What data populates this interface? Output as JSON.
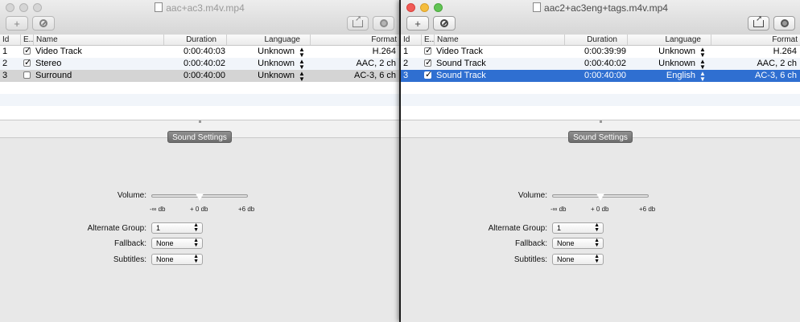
{
  "windows": {
    "left": {
      "title": "aac+ac3.m4v.mp4",
      "headers": {
        "id": "Id",
        "enabled": "E...",
        "name": "Name",
        "duration": "Duration",
        "language": "Language",
        "format": "Format"
      },
      "tracks": [
        {
          "id": "1",
          "enabled": true,
          "name": "Video Track",
          "duration": "0:00:40:03",
          "language": "Unknown",
          "format": "H.264"
        },
        {
          "id": "2",
          "enabled": true,
          "name": "Stereo",
          "duration": "0:00:40:02",
          "language": "Unknown",
          "format": "AAC, 2 ch"
        },
        {
          "id": "3",
          "enabled": false,
          "name": "Surround",
          "duration": "0:00:40:00",
          "language": "Unknown",
          "format": "AC-3, 6 ch"
        }
      ],
      "settings_tab": "Sound Settings",
      "volume_label": "Volume:",
      "volume_ticks": {
        "min": "-∞ db",
        "mid": "+ 0 db",
        "max": "+6 db"
      },
      "volume_level": 0.5,
      "alternate_group_label": "Alternate Group:",
      "alternate_group_value": "1",
      "fallback_label": "Fallback:",
      "fallback_value": "None",
      "subtitles_label": "Subtitles:",
      "subtitles_value": "None"
    },
    "right": {
      "title": "aac2+ac3eng+tags.m4v.mp4",
      "headers": {
        "id": "Id",
        "enabled": "E...",
        "name": "Name",
        "duration": "Duration",
        "language": "Language",
        "format": "Format"
      },
      "tracks": [
        {
          "id": "1",
          "enabled": true,
          "name": "Video Track",
          "duration": "0:00:39:99",
          "language": "Unknown",
          "format": "H.264"
        },
        {
          "id": "2",
          "enabled": true,
          "name": "Sound Track",
          "duration": "0:00:40:02",
          "language": "Unknown",
          "format": "AAC, 2 ch"
        },
        {
          "id": "3",
          "enabled": true,
          "name": "Sound Track",
          "duration": "0:00:40:00",
          "language": "English",
          "format": "AC-3, 6 ch"
        }
      ],
      "settings_tab": "Sound Settings",
      "volume_label": "Volume:",
      "volume_ticks": {
        "min": "-∞ db",
        "mid": "+ 0 db",
        "max": "+6 db"
      },
      "volume_level": 0.5,
      "alternate_group_label": "Alternate Group:",
      "alternate_group_value": "1",
      "fallback_label": "Fallback:",
      "fallback_value": "None",
      "subtitles_label": "Subtitles:",
      "subtitles_value": "None"
    }
  },
  "toolbar": {
    "add_symbol": "+",
    "remove_icon": "circle-slash-icon",
    "share_icon": "share-icon",
    "inspect_icon": "magnifier-icon"
  },
  "colors": {
    "selection_blue": "#2f6fd1",
    "selection_gray": "#d4d4d4",
    "alt_row": "#f1f5fa"
  }
}
